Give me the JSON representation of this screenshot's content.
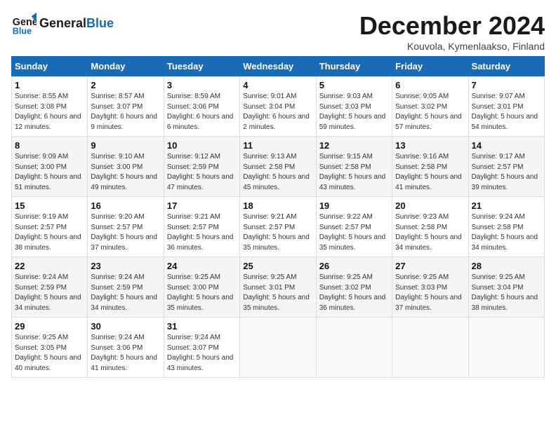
{
  "header": {
    "logo_general": "General",
    "logo_blue": "Blue",
    "month": "December 2024",
    "location": "Kouvola, Kymenlaakso, Finland"
  },
  "weekdays": [
    "Sunday",
    "Monday",
    "Tuesday",
    "Wednesday",
    "Thursday",
    "Friday",
    "Saturday"
  ],
  "weeks": [
    [
      {
        "day": "1",
        "sunrise": "Sunrise: 8:55 AM",
        "sunset": "Sunset: 3:08 PM",
        "daylight": "Daylight: 6 hours and 12 minutes."
      },
      {
        "day": "2",
        "sunrise": "Sunrise: 8:57 AM",
        "sunset": "Sunset: 3:07 PM",
        "daylight": "Daylight: 6 hours and 9 minutes."
      },
      {
        "day": "3",
        "sunrise": "Sunrise: 8:59 AM",
        "sunset": "Sunset: 3:06 PM",
        "daylight": "Daylight: 6 hours and 6 minutes."
      },
      {
        "day": "4",
        "sunrise": "Sunrise: 9:01 AM",
        "sunset": "Sunset: 3:04 PM",
        "daylight": "Daylight: 6 hours and 2 minutes."
      },
      {
        "day": "5",
        "sunrise": "Sunrise: 9:03 AM",
        "sunset": "Sunset: 3:03 PM",
        "daylight": "Daylight: 5 hours and 59 minutes."
      },
      {
        "day": "6",
        "sunrise": "Sunrise: 9:05 AM",
        "sunset": "Sunset: 3:02 PM",
        "daylight": "Daylight: 5 hours and 57 minutes."
      },
      {
        "day": "7",
        "sunrise": "Sunrise: 9:07 AM",
        "sunset": "Sunset: 3:01 PM",
        "daylight": "Daylight: 5 hours and 54 minutes."
      }
    ],
    [
      {
        "day": "8",
        "sunrise": "Sunrise: 9:09 AM",
        "sunset": "Sunset: 3:00 PM",
        "daylight": "Daylight: 5 hours and 51 minutes."
      },
      {
        "day": "9",
        "sunrise": "Sunrise: 9:10 AM",
        "sunset": "Sunset: 3:00 PM",
        "daylight": "Daylight: 5 hours and 49 minutes."
      },
      {
        "day": "10",
        "sunrise": "Sunrise: 9:12 AM",
        "sunset": "Sunset: 2:59 PM",
        "daylight": "Daylight: 5 hours and 47 minutes."
      },
      {
        "day": "11",
        "sunrise": "Sunrise: 9:13 AM",
        "sunset": "Sunset: 2:58 PM",
        "daylight": "Daylight: 5 hours and 45 minutes."
      },
      {
        "day": "12",
        "sunrise": "Sunrise: 9:15 AM",
        "sunset": "Sunset: 2:58 PM",
        "daylight": "Daylight: 5 hours and 43 minutes."
      },
      {
        "day": "13",
        "sunrise": "Sunrise: 9:16 AM",
        "sunset": "Sunset: 2:58 PM",
        "daylight": "Daylight: 5 hours and 41 minutes."
      },
      {
        "day": "14",
        "sunrise": "Sunrise: 9:17 AM",
        "sunset": "Sunset: 2:57 PM",
        "daylight": "Daylight: 5 hours and 39 minutes."
      }
    ],
    [
      {
        "day": "15",
        "sunrise": "Sunrise: 9:19 AM",
        "sunset": "Sunset: 2:57 PM",
        "daylight": "Daylight: 5 hours and 38 minutes."
      },
      {
        "day": "16",
        "sunrise": "Sunrise: 9:20 AM",
        "sunset": "Sunset: 2:57 PM",
        "daylight": "Daylight: 5 hours and 37 minutes."
      },
      {
        "day": "17",
        "sunrise": "Sunrise: 9:21 AM",
        "sunset": "Sunset: 2:57 PM",
        "daylight": "Daylight: 5 hours and 36 minutes."
      },
      {
        "day": "18",
        "sunrise": "Sunrise: 9:21 AM",
        "sunset": "Sunset: 2:57 PM",
        "daylight": "Daylight: 5 hours and 35 minutes."
      },
      {
        "day": "19",
        "sunrise": "Sunrise: 9:22 AM",
        "sunset": "Sunset: 2:57 PM",
        "daylight": "Daylight: 5 hours and 35 minutes."
      },
      {
        "day": "20",
        "sunrise": "Sunrise: 9:23 AM",
        "sunset": "Sunset: 2:58 PM",
        "daylight": "Daylight: 5 hours and 34 minutes."
      },
      {
        "day": "21",
        "sunrise": "Sunrise: 9:24 AM",
        "sunset": "Sunset: 2:58 PM",
        "daylight": "Daylight: 5 hours and 34 minutes."
      }
    ],
    [
      {
        "day": "22",
        "sunrise": "Sunrise: 9:24 AM",
        "sunset": "Sunset: 2:59 PM",
        "daylight": "Daylight: 5 hours and 34 minutes."
      },
      {
        "day": "23",
        "sunrise": "Sunrise: 9:24 AM",
        "sunset": "Sunset: 2:59 PM",
        "daylight": "Daylight: 5 hours and 34 minutes."
      },
      {
        "day": "24",
        "sunrise": "Sunrise: 9:25 AM",
        "sunset": "Sunset: 3:00 PM",
        "daylight": "Daylight: 5 hours and 35 minutes."
      },
      {
        "day": "25",
        "sunrise": "Sunrise: 9:25 AM",
        "sunset": "Sunset: 3:01 PM",
        "daylight": "Daylight: 5 hours and 35 minutes."
      },
      {
        "day": "26",
        "sunrise": "Sunrise: 9:25 AM",
        "sunset": "Sunset: 3:02 PM",
        "daylight": "Daylight: 5 hours and 36 minutes."
      },
      {
        "day": "27",
        "sunrise": "Sunrise: 9:25 AM",
        "sunset": "Sunset: 3:03 PM",
        "daylight": "Daylight: 5 hours and 37 minutes."
      },
      {
        "day": "28",
        "sunrise": "Sunrise: 9:25 AM",
        "sunset": "Sunset: 3:04 PM",
        "daylight": "Daylight: 5 hours and 38 minutes."
      }
    ],
    [
      {
        "day": "29",
        "sunrise": "Sunrise: 9:25 AM",
        "sunset": "Sunset: 3:05 PM",
        "daylight": "Daylight: 5 hours and 40 minutes."
      },
      {
        "day": "30",
        "sunrise": "Sunrise: 9:24 AM",
        "sunset": "Sunset: 3:06 PM",
        "daylight": "Daylight: 5 hours and 41 minutes."
      },
      {
        "day": "31",
        "sunrise": "Sunrise: 9:24 AM",
        "sunset": "Sunset: 3:07 PM",
        "daylight": "Daylight: 5 hours and 43 minutes."
      },
      null,
      null,
      null,
      null
    ]
  ]
}
